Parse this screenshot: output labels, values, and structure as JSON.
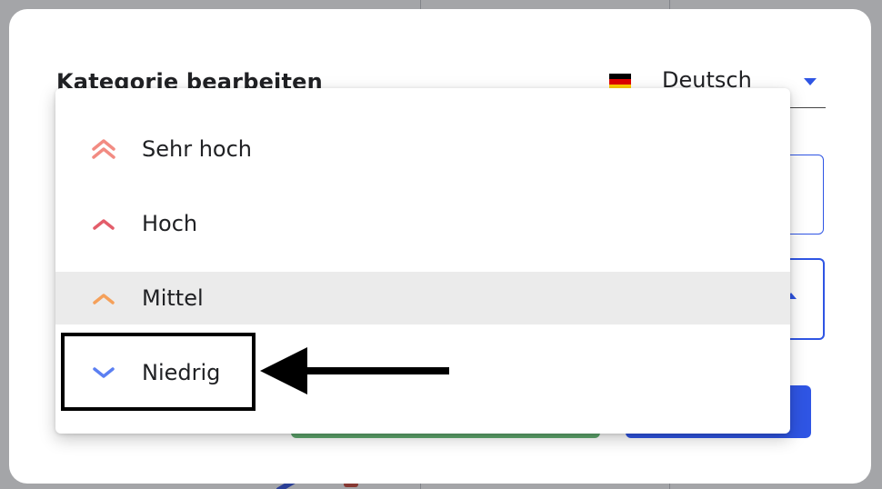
{
  "modal": {
    "title": "Kategorie bearbeiten",
    "language": {
      "selected": "Deutsch",
      "flag_colors": [
        "#000000",
        "#dd0000",
        "#ffce00"
      ]
    }
  },
  "priority_menu": {
    "items": [
      {
        "label": "Sehr hoch",
        "icon": "double-chevron-up-icon",
        "color": "#f28b82"
      },
      {
        "label": "Hoch",
        "icon": "chevron-up-icon",
        "color": "#e35d6a"
      },
      {
        "label": "Mittel",
        "icon": "chevron-up-icon",
        "color": "#f5a05a",
        "hovered": true
      },
      {
        "label": "Niedrig",
        "icon": "chevron-down-icon",
        "color": "#5b7ff2"
      }
    ]
  },
  "colors": {
    "accent": "#2f55e4",
    "confirm": "#5ea86e",
    "annotation": "#000000"
  }
}
